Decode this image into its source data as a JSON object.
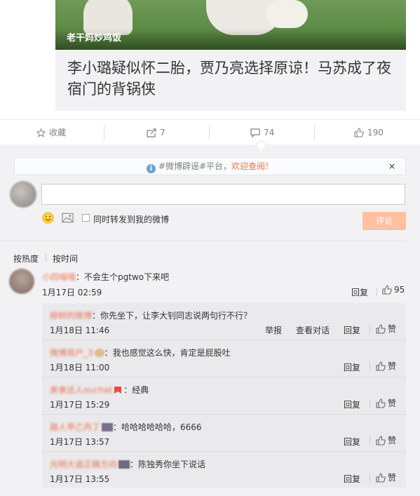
{
  "article": {
    "source": "老干妈炒鸡饭",
    "headline": "李小璐疑似怀二胎，贾乃亮选择原谅！马苏成了夜宿门的背锅侠"
  },
  "actions": {
    "favorite_label": "收藏",
    "repost_count": "7",
    "comment_count": "74",
    "like_count": "190"
  },
  "notice": {
    "prefix": "#微博辟谣#平台，",
    "highlight": "欢迎查阅！",
    "close": "×"
  },
  "composer": {
    "input_value": "",
    "repost_label": "同时转发到我的微博",
    "submit_label": "评论"
  },
  "sort": {
    "hot": "按热度",
    "time": "按时间"
  },
  "top_comment": {
    "username": "小四喵喵",
    "text": "：不会生个pgtwo下来吧",
    "time": "1月17日 02:59",
    "reply": "回复",
    "likes": "95"
  },
  "replies": [
    {
      "username": "柳树的微博",
      "text": "：你先坐下，让李大钊同志说两句行不行？",
      "time": "1月18日 11:46",
      "report": "举报",
      "conversation": "查看对话",
      "reply": "回复",
      "like": "赞"
    },
    {
      "username": "微博用户_3",
      "text": "：我也感觉这么快，肯定是屁股吐",
      "time": "1月18日 11:00",
      "reply": "回复",
      "like": "赞"
    },
    {
      "username": "美食达人ouchat",
      "text": "：经典",
      "time": "1月17日 15:29",
      "reply": "回复",
      "like": "赞"
    },
    {
      "username": "路人甲乙丙丁",
      "text": "：哈哈哈哈哈哈，6666",
      "time": "1月17日 13:57",
      "reply": "回复",
      "like": "赞"
    },
    {
      "username": "光明大道正确方向",
      "text": "：陈独秀你坐下说话",
      "time": "1月17日 13:55",
      "reply": "回复",
      "like": "赞"
    }
  ],
  "colors": {
    "accent": "#eb7350",
    "submit_disabled": "#ffc09f",
    "panel_bg": "#f2f2f5"
  }
}
